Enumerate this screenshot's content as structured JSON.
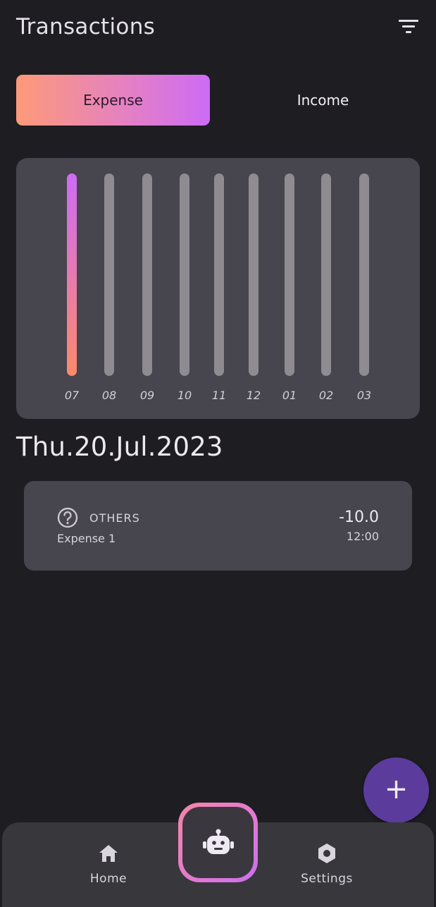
{
  "header": {
    "title": "Transactions",
    "filter_icon": "filter-icon"
  },
  "tabs": [
    {
      "label": "Expense",
      "active": true
    },
    {
      "label": "Income",
      "active": false
    }
  ],
  "chart_data": {
    "type": "bar",
    "categories": [
      "07",
      "08",
      "09",
      "10",
      "11",
      "12",
      "01",
      "02",
      "03"
    ],
    "series": [
      {
        "values": [
          10.0,
          0,
          0,
          0,
          0,
          0,
          0,
          0,
          0
        ]
      }
    ],
    "highlighted_index": 0,
    "colors": {
      "active_gradient": [
        "#fd8a6a",
        "#cd6bf6"
      ],
      "inactive": "#8e8c91"
    }
  },
  "date_heading": "Thu.20.Jul.2023",
  "transactions": [
    {
      "icon": "question-circle-icon",
      "category": "OTHERS",
      "note": "Expense 1",
      "amount": "-10.0",
      "time": "12:00"
    }
  ],
  "fab": {
    "icon": "plus-icon",
    "label": "+"
  },
  "bottom_nav": {
    "home_label": "Home",
    "home_icon": "home-icon",
    "settings_label": "Settings",
    "settings_icon": "settings-hexagon-icon",
    "center_icon": "robot-icon"
  },
  "colors": {
    "background": "#1e1d22",
    "card": "#47454e",
    "fab": "#5b3c9c",
    "accent_gradient": [
      "#fd9a78",
      "#cd6bf6"
    ]
  }
}
